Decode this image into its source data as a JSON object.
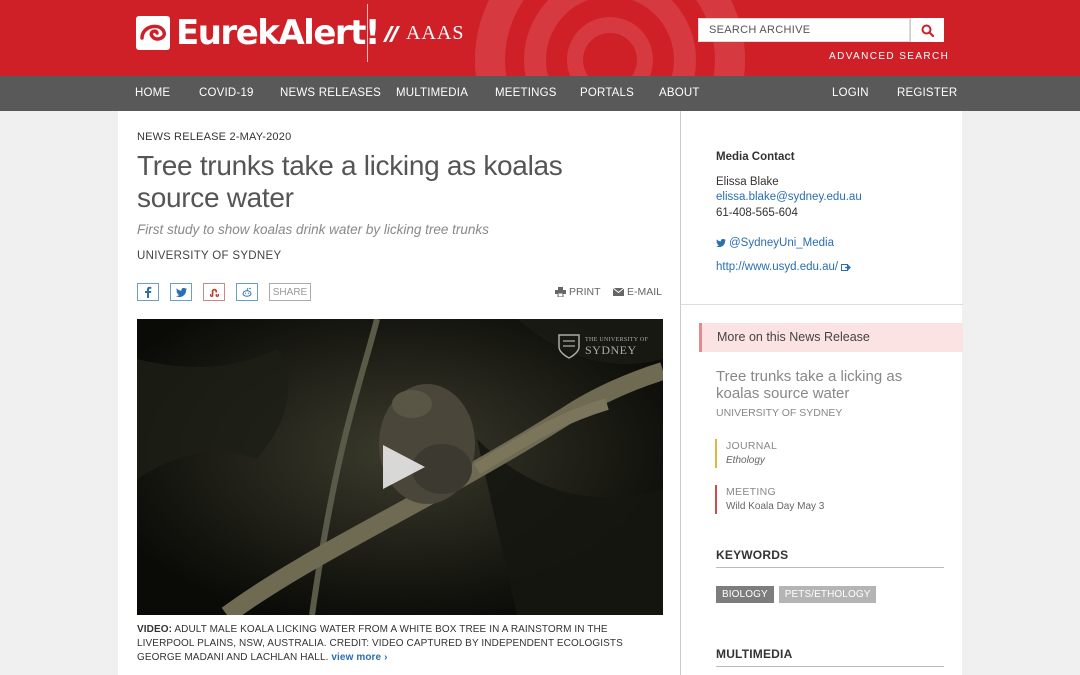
{
  "header": {
    "logo_text": "EurekAlert!",
    "aaas_text": "AAAS",
    "search_placeholder": "SEARCH ARCHIVE",
    "advanced_search": "ADVANCED SEARCH",
    "brand_color": "#cf2027"
  },
  "nav": {
    "items": [
      "HOME",
      "COVID-19",
      "NEWS RELEASES",
      "MULTIMEDIA",
      "MEETINGS",
      "PORTALS",
      "ABOUT"
    ],
    "login": "LOGIN",
    "register": "REGISTER"
  },
  "article": {
    "release_date": "NEWS RELEASE 2-MAY-2020",
    "title": "Tree trunks take a licking as koalas source water",
    "subtitle": "First study to show koalas drink water by licking tree trunks",
    "institution": "UNIVERSITY OF SYDNEY",
    "share_label": "SHARE",
    "print_label": "PRINT",
    "email_label": "E-MAIL",
    "video_watermark_small": "THE UNIVERSITY OF",
    "video_watermark_big": "SYDNEY",
    "caption_label": "VIDEO:",
    "caption_text": "ADULT MALE KOALA LICKING WATER FROM A WHITE BOX TREE IN A RAINSTORM IN THE LIVERPOOL PLAINS, NSW, AUSTRALIA. CREDIT: VIDEO CAPTURED BY INDEPENDENT ECOLOGISTS GEORGE MADANI AND LACHLAN HALL.",
    "view_more": "view more"
  },
  "sidebar": {
    "media_contact_label": "Media Contact",
    "contact_name": "Elissa Blake",
    "contact_email": "elissa.blake@sydney.edu.au",
    "contact_phone": "61-408-565-604",
    "twitter": "@SydneyUni_Media",
    "website": "http://www.usyd.edu.au/",
    "more_on_label": "More on this News Release",
    "related_title": "Tree trunks take a licking as koalas source water",
    "related_institution": "UNIVERSITY OF SYDNEY",
    "journal_label": "JOURNAL",
    "journal_value": "Ethology",
    "meeting_label": "MEETING",
    "meeting_value": "Wild Koala Day May 3",
    "keywords_label": "KEYWORDS",
    "keywords": [
      "BIOLOGY",
      "PETS/ETHOLOGY"
    ],
    "multimedia_label": "MULTIMEDIA"
  }
}
